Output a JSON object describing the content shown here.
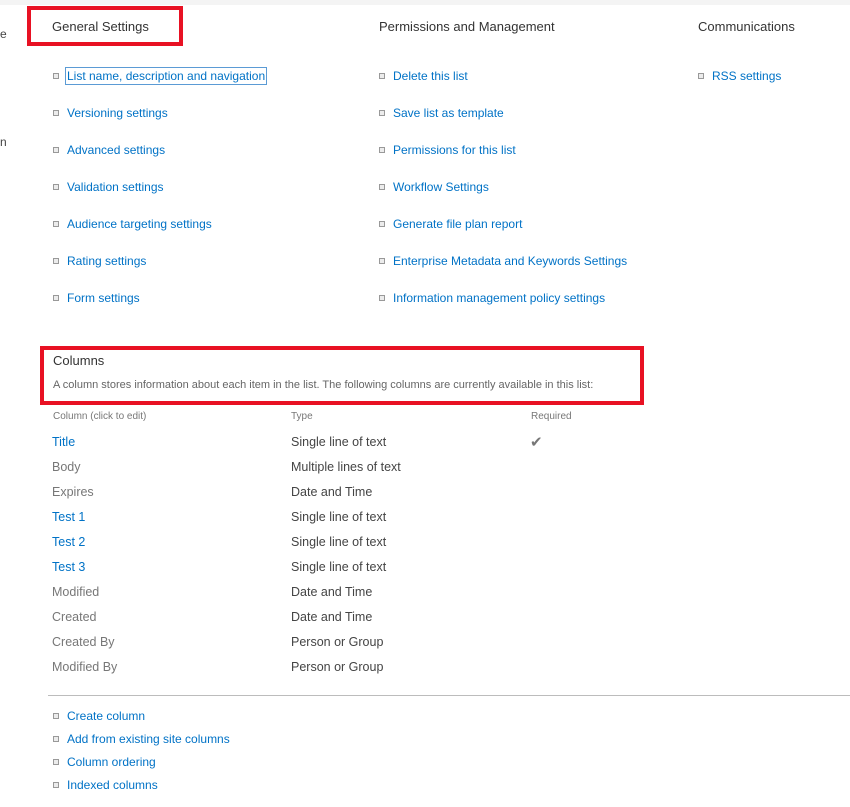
{
  "left_fragments": [
    "e",
    "n"
  ],
  "general": {
    "header": "General Settings",
    "links": [
      "List name, description and navigation",
      "Versioning settings",
      "Advanced settings",
      "Validation settings",
      "Audience targeting settings",
      "Rating settings",
      "Form settings"
    ]
  },
  "permissions": {
    "header": "Permissions and Management",
    "links": [
      "Delete this list",
      "Save list as template",
      "Permissions for this list",
      "Workflow Settings",
      "Generate file plan report",
      "Enterprise Metadata and Keywords Settings",
      "Information management policy settings"
    ]
  },
  "communications": {
    "header": "Communications",
    "links": [
      "RSS settings"
    ]
  },
  "columns": {
    "title": "Columns",
    "description": "A column stores information about each item in the list. The following columns are currently available in this list:",
    "headers": {
      "name": "Column (click to edit)",
      "type": "Type",
      "required": "Required"
    },
    "rows": [
      {
        "name": "Title",
        "type": "Single line of text",
        "required": true,
        "link": true
      },
      {
        "name": "Body",
        "type": "Multiple lines of text",
        "required": false,
        "link": false
      },
      {
        "name": "Expires",
        "type": "Date and Time",
        "required": false,
        "link": false
      },
      {
        "name": "Test 1",
        "type": "Single line of text",
        "required": false,
        "link": true
      },
      {
        "name": "Test 2",
        "type": "Single line of text",
        "required": false,
        "link": true
      },
      {
        "name": "Test 3",
        "type": "Single line of text",
        "required": false,
        "link": true
      },
      {
        "name": "Modified",
        "type": "Date and Time",
        "required": false,
        "link": false
      },
      {
        "name": "Created",
        "type": "Date and Time",
        "required": false,
        "link": false
      },
      {
        "name": "Created By",
        "type": "Person or Group",
        "required": false,
        "link": false
      },
      {
        "name": "Modified By",
        "type": "Person or Group",
        "required": false,
        "link": false
      }
    ],
    "actions": [
      "Create column",
      "Add from existing site columns",
      "Column ordering",
      "Indexed columns"
    ]
  },
  "colors": {
    "link": "#0072c6",
    "highlight": "#e81123",
    "text": "#444444"
  }
}
